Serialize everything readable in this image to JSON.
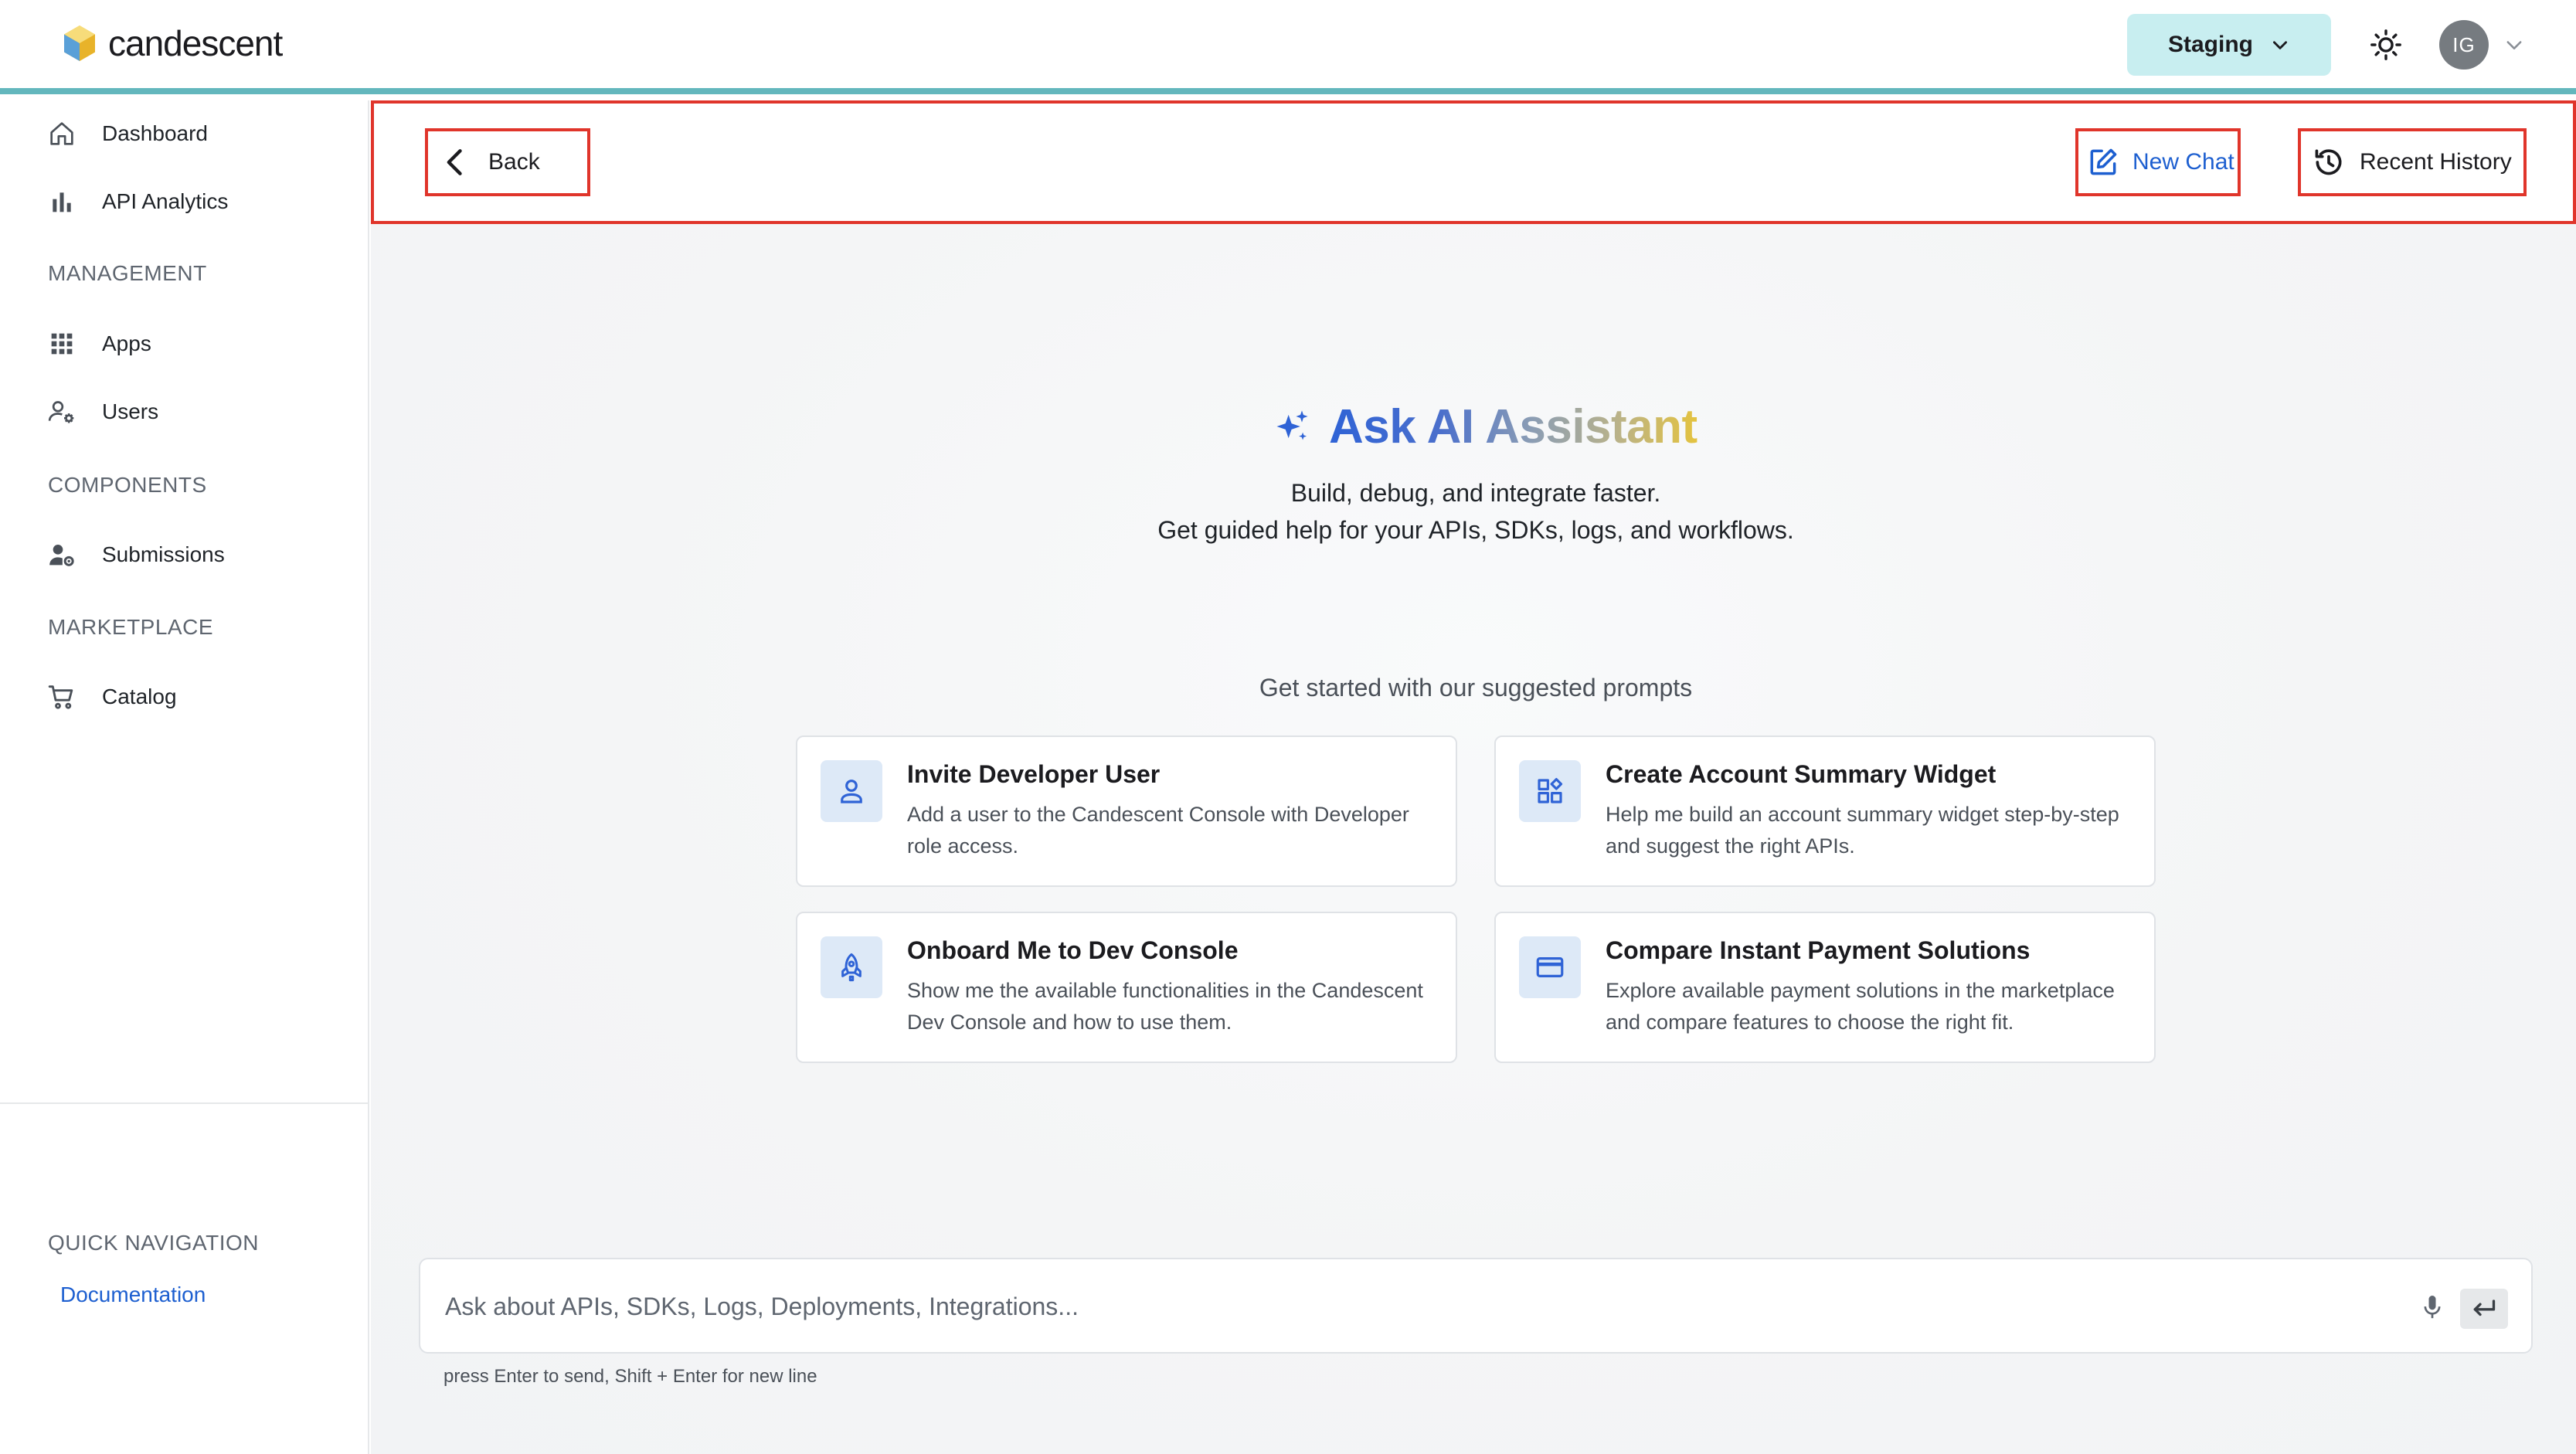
{
  "header": {
    "logo_text": "candescent",
    "environment": "Staging",
    "avatar_initials": "IG",
    "icons": {
      "logo": "candescent-hexagon-logo",
      "environment_caret": "chevron-down-icon",
      "theme": "sun-icon",
      "account_caret": "chevron-down-icon"
    }
  },
  "sidebar": {
    "top_items": [
      {
        "label": "Dashboard",
        "icon": "home-icon"
      },
      {
        "label": "API Analytics",
        "icon": "bar-chart-icon"
      }
    ],
    "sections": [
      {
        "title": "MANAGEMENT",
        "items": [
          {
            "label": "Apps",
            "icon": "grid-icon"
          },
          {
            "label": "Users",
            "icon": "user-settings-icon"
          }
        ]
      },
      {
        "title": "COMPONENTS",
        "items": [
          {
            "label": "Submissions",
            "icon": "user-gear-icon"
          }
        ]
      },
      {
        "title": "MARKETPLACE",
        "items": [
          {
            "label": "Catalog",
            "icon": "cart-icon"
          }
        ]
      }
    ],
    "quick_navigation": {
      "title": "QUICK NAVIGATION",
      "links": [
        {
          "label": "Documentation"
        }
      ]
    }
  },
  "toolbar": {
    "back_label": "Back",
    "new_chat_label": "New Chat",
    "recent_history_label": "Recent History"
  },
  "hero": {
    "title": "Ask AI Assistant",
    "subtitle_line1": "Build, debug, and integrate faster.",
    "subtitle_line2": "Get guided help for your APIs, SDKs, logs, and workflows."
  },
  "suggestions": {
    "label": "Get started with our suggested prompts",
    "cards": [
      {
        "title": "Invite Developer User",
        "description": "Add a user to the Candescent Console with Developer role access.",
        "icon": "user-icon"
      },
      {
        "title": "Create Account Summary Widget",
        "description": "Help me build an account summary widget step-by-step and suggest the right APIs.",
        "icon": "widgets-icon"
      },
      {
        "title": "Onboard Me to Dev Console",
        "description": "Show me the available functionalities in the Candescent Dev Console and how to use them.",
        "icon": "rocket-icon"
      },
      {
        "title": "Compare Instant Payment Solutions",
        "description": "Explore available payment solutions in the marketplace and compare features to choose the right fit.",
        "icon": "credit-card-icon"
      }
    ]
  },
  "chat": {
    "placeholder": "Ask about APIs, SDKs, Logs, Deployments, Integrations...",
    "value": "",
    "hint": "press Enter to send, Shift + Enter for new line"
  },
  "colors": {
    "accent_teal": "#63b7bd",
    "environment_bg": "#c8eef0",
    "link_blue": "#1d5fd0",
    "highlight_red": "#e0352b",
    "title_gradient_start": "#2f63d6",
    "title_gradient_end": "#e4c33f"
  }
}
